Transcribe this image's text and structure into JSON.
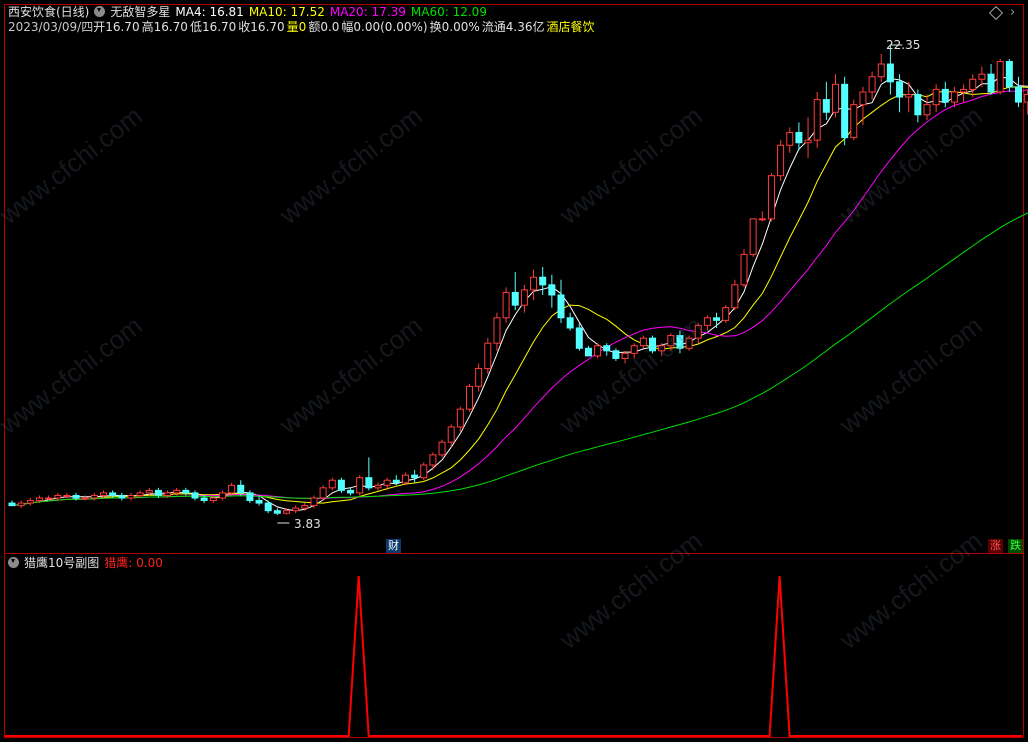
{
  "header": {
    "stock_name": "西安饮食(日线)",
    "indicator_name": "无敌智多星",
    "ma4": "MA4: 16.81",
    "ma10": "MA10: 17.52",
    "ma20": "MA20: 17.39",
    "ma60": "MA60: 12.09",
    "date": "2023/03/09/四",
    "open": "开16.70",
    "high": "高16.70",
    "low": "低16.70",
    "close": "收16.70",
    "volume_label": "量",
    "volume_value": "0",
    "amount": "额0.0",
    "change": "幅0.00(0.00%)",
    "turnover": "换0.00%",
    "float_cap": "流通4.36亿",
    "sector": "酒店餐饮"
  },
  "labels": {
    "high_price": "22.35",
    "low_price": "3.83",
    "finance_badge": "财",
    "rise_badge": "涨",
    "fall_badge": "跌"
  },
  "sub_panel": {
    "title": "猎鹰10号副图",
    "value_label": "猎鹰: 0.00"
  },
  "watermark": "www.cfchi.com",
  "colors": {
    "up": "#ff3c3c",
    "down": "#54ffff",
    "ma4": "#ffffff",
    "ma10": "#ffff00",
    "ma20": "#ff00ff",
    "ma60": "#00e000",
    "frame": "#b00000",
    "signal": "#ff0000"
  },
  "chart_data": {
    "type": "candlestick",
    "candles": [
      [
        4.3,
        4.4,
        4.2,
        4.2
      ],
      [
        4.2,
        4.4,
        4.1,
        4.3
      ],
      [
        4.3,
        4.5,
        4.2,
        4.4
      ],
      [
        4.4,
        4.6,
        4.3,
        4.5
      ],
      [
        4.5,
        4.6,
        4.4,
        4.5
      ],
      [
        4.5,
        4.7,
        4.4,
        4.6
      ],
      [
        4.6,
        4.7,
        4.5,
        4.6
      ],
      [
        4.6,
        4.7,
        4.4,
        4.5
      ],
      [
        4.5,
        4.6,
        4.4,
        4.5
      ],
      [
        4.5,
        4.7,
        4.4,
        4.6
      ],
      [
        4.6,
        4.8,
        4.5,
        4.7
      ],
      [
        4.7,
        4.8,
        4.5,
        4.6
      ],
      [
        4.6,
        4.7,
        4.4,
        4.5
      ],
      [
        4.5,
        4.7,
        4.4,
        4.6
      ],
      [
        4.6,
        4.8,
        4.5,
        4.7
      ],
      [
        4.7,
        4.9,
        4.6,
        4.8
      ],
      [
        4.8,
        4.9,
        4.5,
        4.6
      ],
      [
        4.6,
        4.8,
        4.5,
        4.7
      ],
      [
        4.7,
        4.9,
        4.6,
        4.8
      ],
      [
        4.8,
        4.9,
        4.6,
        4.7
      ],
      [
        4.7,
        4.8,
        4.4,
        4.5
      ],
      [
        4.5,
        4.6,
        4.3,
        4.4
      ],
      [
        4.4,
        4.6,
        4.3,
        4.5
      ],
      [
        4.5,
        4.8,
        4.4,
        4.7
      ],
      [
        4.7,
        5.1,
        4.6,
        5.0
      ],
      [
        5.0,
        5.2,
        4.6,
        4.7
      ],
      [
        4.7,
        4.8,
        4.3,
        4.4
      ],
      [
        4.4,
        4.6,
        4.2,
        4.3
      ],
      [
        4.3,
        4.4,
        3.9,
        4.0
      ],
      [
        4.0,
        4.1,
        3.83,
        3.9
      ],
      [
        3.9,
        4.1,
        3.85,
        4.0
      ],
      [
        4.0,
        4.2,
        3.9,
        4.1
      ],
      [
        4.1,
        4.3,
        4.0,
        4.2
      ],
      [
        4.2,
        4.6,
        4.1,
        4.5
      ],
      [
        4.5,
        5.0,
        4.4,
        4.9
      ],
      [
        4.9,
        5.3,
        4.8,
        5.2
      ],
      [
        5.2,
        5.3,
        4.7,
        4.8
      ],
      [
        4.8,
        4.9,
        4.6,
        4.7
      ],
      [
        4.7,
        5.4,
        4.6,
        5.3
      ],
      [
        5.3,
        6.1,
        4.8,
        4.9
      ],
      [
        4.9,
        5.1,
        4.8,
        5.0
      ],
      [
        5.0,
        5.3,
        4.8,
        5.2
      ],
      [
        5.2,
        5.4,
        5.0,
        5.1
      ],
      [
        5.1,
        5.5,
        5.0,
        5.4
      ],
      [
        5.4,
        5.6,
        5.1,
        5.3
      ],
      [
        5.3,
        5.9,
        5.2,
        5.8
      ],
      [
        5.8,
        6.3,
        5.6,
        6.2
      ],
      [
        6.2,
        6.8,
        6.1,
        6.7
      ],
      [
        6.7,
        7.4,
        6.5,
        7.3
      ],
      [
        7.3,
        8.1,
        7.1,
        8.0
      ],
      [
        8.0,
        9.0,
        7.9,
        8.9
      ],
      [
        8.9,
        9.8,
        8.7,
        9.6
      ],
      [
        9.6,
        10.8,
        9.4,
        10.6
      ],
      [
        10.6,
        11.8,
        10.3,
        11.6
      ],
      [
        11.6,
        12.8,
        11.4,
        12.6
      ],
      [
        12.6,
        13.4,
        11.9,
        12.1
      ],
      [
        12.1,
        12.9,
        11.8,
        12.7
      ],
      [
        12.7,
        13.5,
        12.3,
        13.2
      ],
      [
        13.2,
        13.6,
        12.5,
        12.9
      ],
      [
        12.9,
        13.3,
        12.0,
        12.5
      ],
      [
        12.5,
        13.1,
        11.4,
        11.6
      ],
      [
        11.6,
        11.8,
        11.1,
        11.2
      ],
      [
        11.2,
        11.4,
        10.3,
        10.4
      ],
      [
        10.4,
        10.5,
        10.1,
        10.1
      ],
      [
        10.1,
        10.6,
        10.0,
        10.5
      ],
      [
        10.5,
        10.6,
        10.1,
        10.3
      ],
      [
        10.3,
        10.4,
        9.9,
        10.0
      ],
      [
        10.0,
        10.3,
        9.8,
        10.2
      ],
      [
        10.2,
        10.6,
        10.0,
        10.5
      ],
      [
        10.5,
        10.9,
        10.4,
        10.8
      ],
      [
        10.8,
        10.9,
        10.2,
        10.3
      ],
      [
        10.3,
        10.6,
        10.1,
        10.5
      ],
      [
        10.5,
        11.0,
        10.3,
        10.9
      ],
      [
        10.9,
        11.1,
        10.2,
        10.4
      ],
      [
        10.4,
        10.9,
        10.3,
        10.8
      ],
      [
        10.8,
        11.4,
        10.6,
        11.3
      ],
      [
        11.3,
        11.7,
        11.1,
        11.6
      ],
      [
        11.6,
        11.8,
        11.2,
        11.5
      ],
      [
        11.5,
        12.1,
        11.4,
        12.0
      ],
      [
        12.0,
        13.1,
        11.9,
        12.9
      ],
      [
        12.9,
        14.3,
        12.8,
        14.1
      ],
      [
        14.1,
        15.5,
        14.0,
        15.5
      ],
      [
        15.5,
        15.8,
        15.4,
        15.5
      ],
      [
        15.5,
        17.3,
        15.4,
        17.2
      ],
      [
        17.2,
        18.6,
        17.0,
        18.4
      ],
      [
        18.4,
        19.1,
        18.1,
        18.9
      ],
      [
        18.9,
        19.3,
        18.2,
        18.5
      ],
      [
        18.5,
        19.5,
        17.9,
        18.6
      ],
      [
        18.6,
        20.5,
        18.3,
        20.2
      ],
      [
        20.2,
        20.9,
        19.4,
        19.7
      ],
      [
        19.7,
        21.2,
        19.5,
        20.8
      ],
      [
        20.8,
        21.1,
        18.4,
        18.7
      ],
      [
        18.7,
        20.2,
        18.6,
        20.0
      ],
      [
        20.0,
        20.7,
        19.2,
        20.5
      ],
      [
        20.5,
        21.3,
        20.2,
        21.1
      ],
      [
        21.1,
        22.0,
        20.9,
        21.6
      ],
      [
        21.6,
        22.35,
        20.4,
        20.9
      ],
      [
        20.9,
        21.2,
        19.7,
        20.3
      ],
      [
        20.3,
        20.9,
        19.7,
        20.4
      ],
      [
        20.4,
        20.6,
        19.3,
        19.6
      ],
      [
        19.6,
        20.4,
        19.4,
        20.0
      ],
      [
        20.0,
        20.8,
        19.7,
        20.6
      ],
      [
        20.6,
        20.9,
        19.9,
        20.1
      ],
      [
        20.1,
        20.7,
        19.9,
        20.5
      ],
      [
        20.5,
        20.8,
        20.1,
        20.6
      ],
      [
        20.6,
        21.2,
        20.3,
        21.0
      ],
      [
        21.0,
        21.5,
        20.7,
        21.2
      ],
      [
        21.2,
        21.6,
        20.4,
        20.5
      ],
      [
        20.5,
        21.8,
        20.4,
        21.7
      ],
      [
        21.7,
        21.8,
        20.5,
        20.7
      ],
      [
        20.7,
        21.1,
        19.9,
        20.1
      ],
      [
        20.1,
        20.6,
        19.6,
        20.4
      ],
      [
        20.4,
        20.5,
        19.8,
        20.0
      ],
      [
        20.0,
        20.9,
        19.9,
        20.8
      ],
      [
        20.8,
        21.3,
        19.8,
        19.9
      ],
      [
        19.9,
        20.0,
        19.4,
        19.5
      ]
    ],
    "high_label": 22.35,
    "low_label": 3.83,
    "signal_series": {
      "name": "猎鹰",
      "current_value": 0.0,
      "spike_indices": [
        38,
        84
      ]
    },
    "moving_averages": [
      "MA4",
      "MA10",
      "MA20",
      "MA60"
    ]
  }
}
